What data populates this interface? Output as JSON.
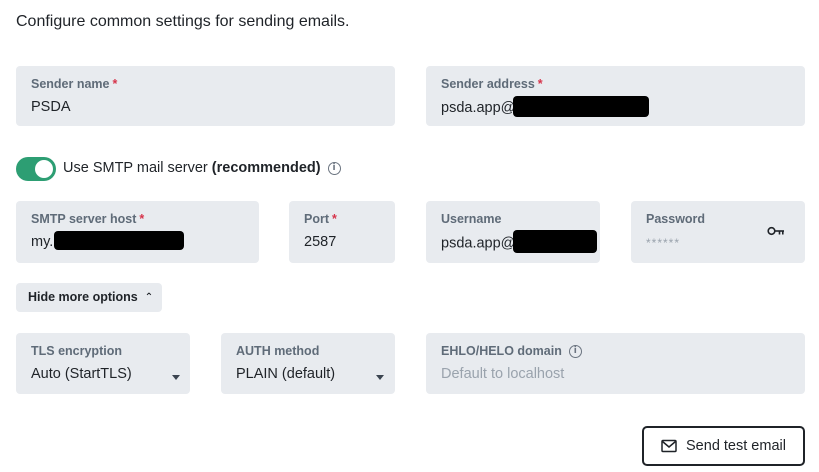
{
  "intro": "Configure common settings for sending emails.",
  "sender_name": {
    "label": "Sender name",
    "required": "*",
    "value": "PSDA"
  },
  "sender_address": {
    "label": "Sender address",
    "required": "*",
    "value": "psda.app@"
  },
  "smtp_toggle": {
    "on": true,
    "label": "Use SMTP mail server",
    "bold": "(recommended)",
    "info_icon": "info-icon"
  },
  "smtp_host": {
    "label": "SMTP server host",
    "required": "*",
    "value": "my."
  },
  "port": {
    "label": "Port",
    "required": "*",
    "value": "2587"
  },
  "username": {
    "label": "Username",
    "value": "psda.app@"
  },
  "password": {
    "label": "Password",
    "value": "******",
    "icon": "key-icon"
  },
  "toggle_options": {
    "label": "Hide more options",
    "icon": "chevron-up-icon"
  },
  "tls": {
    "label": "TLS encryption",
    "value": "Auto (StartTLS)"
  },
  "auth": {
    "label": "AUTH method",
    "value": "PLAIN (default)"
  },
  "ehlo": {
    "label": "EHLO/HELO domain",
    "placeholder": "Default to localhost",
    "info_icon": "info-icon"
  },
  "send_test": {
    "label": "Send test email",
    "icon": "mail-icon"
  },
  "colors": {
    "toggle_on": "#2d9e73",
    "field_bg": "#e8ebef",
    "required": "#d6334a",
    "label": "#5f6b78"
  }
}
